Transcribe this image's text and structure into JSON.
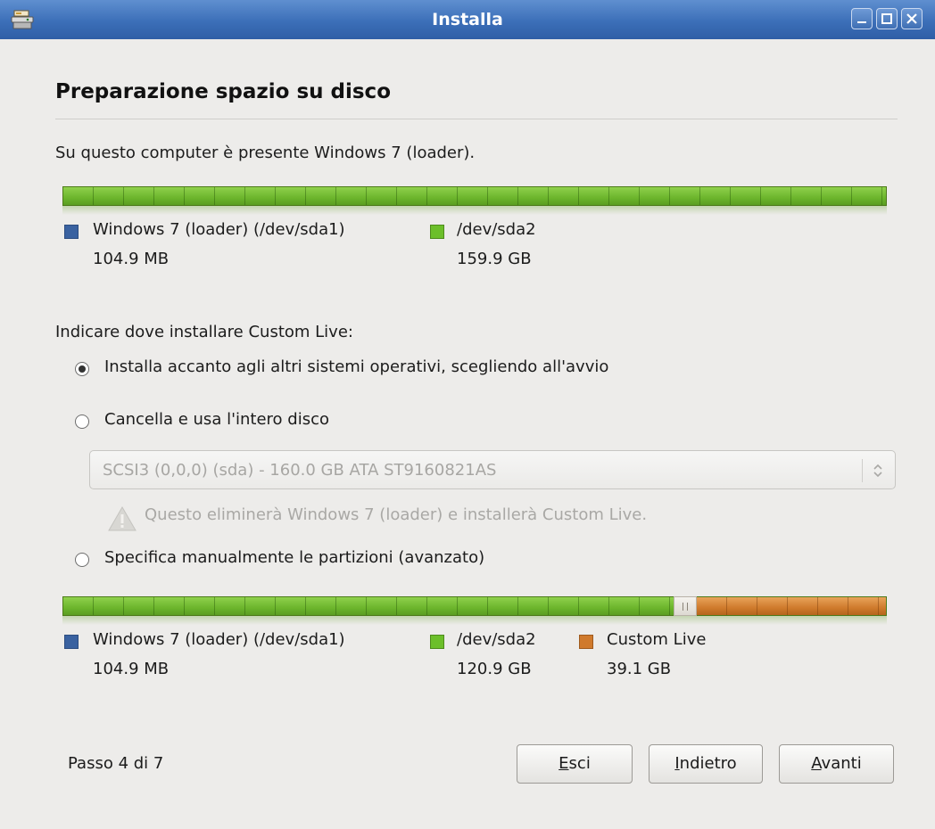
{
  "window": {
    "title": "Installa"
  },
  "page": {
    "heading": "Preparazione spazio su disco",
    "detected_os": "Su questo computer è presente Windows 7 (loader)."
  },
  "current_layout": {
    "partitions": [
      {
        "name": "Windows 7 (loader) (/dev/sda1)",
        "size": "104.9 MB",
        "color": "#3a62a0",
        "fraction": 0.0007
      },
      {
        "name": "/dev/sda2",
        "size": "159.9 GB",
        "color": "#6cbf2a",
        "fraction": 0.9993
      }
    ]
  },
  "install": {
    "prompt": "Indicare dove installare Custom Live:",
    "options": [
      {
        "label": "Installa accanto agli altri sistemi operativi, scegliendo all'avvio",
        "selected": true
      },
      {
        "label": "Cancella e usa l'intero disco",
        "selected": false
      },
      {
        "label": "Specifica manualmente le partizioni (avanzato)",
        "selected": false
      }
    ],
    "disk_select": {
      "value": "SCSI3 (0,0,0) (sda) - 160.0 GB ATA ST9160821AS",
      "enabled": false
    },
    "warning": "Questo eliminerà Windows 7 (loader) e installerà Custom Live."
  },
  "new_layout": {
    "partitions": [
      {
        "name": "Windows 7 (loader) (/dev/sda1)",
        "size": "104.9 MB",
        "color": "#3a62a0",
        "fraction": 0.0007
      },
      {
        "name": "/dev/sda2",
        "size": "120.9 GB",
        "color": "#6cbf2a",
        "fraction": 0.7553
      },
      {
        "name": "Custom Live",
        "size": "39.1 GB",
        "color": "#d07a2c",
        "fraction": 0.244
      }
    ]
  },
  "footer": {
    "step": "Passo 4 di 7",
    "buttons": {
      "quit": {
        "mnemonic": "E",
        "rest": "sci"
      },
      "back": {
        "mnemonic": "I",
        "rest": "ndietro"
      },
      "forward": {
        "mnemonic": "A",
        "rest": "vanti"
      }
    }
  },
  "icons": {
    "app": "installer-icon",
    "minimize": "minimize-icon",
    "maximize": "maximize-icon",
    "close": "close-icon",
    "warning": "warning-icon",
    "combo": "chevron-up-down-icon"
  }
}
